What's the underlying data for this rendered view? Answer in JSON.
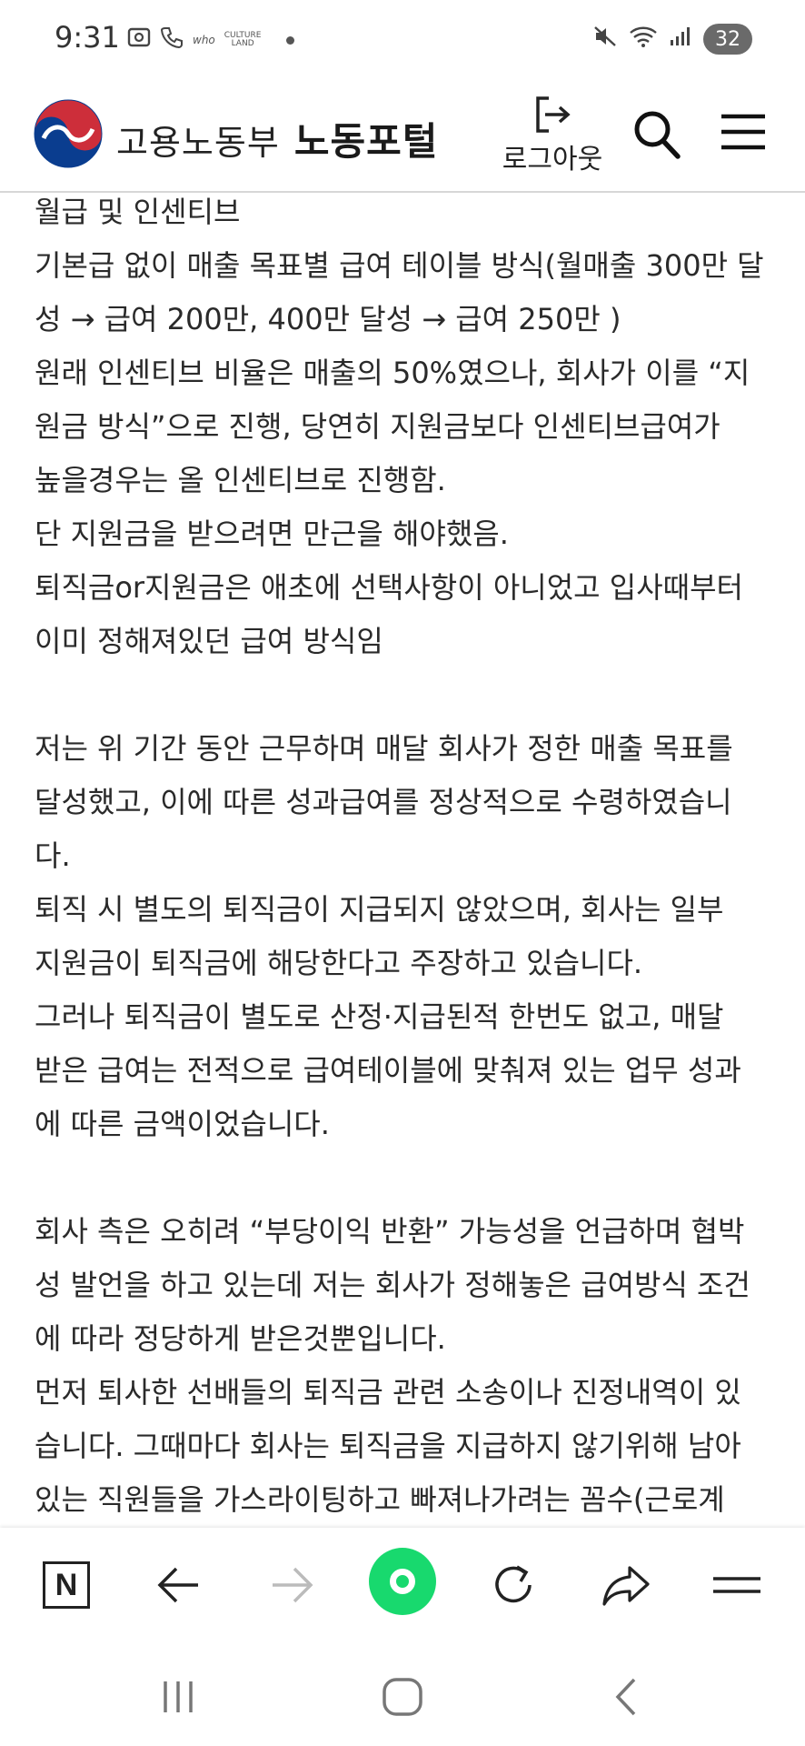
{
  "status_bar": {
    "time": "9:31",
    "battery": "32",
    "left_icons": [
      "gallery-icon",
      "phone-call-icon",
      "who-icon",
      "culture-land-icon"
    ],
    "right_icons": [
      "mute-icon",
      "wifi-icon",
      "signal-icon"
    ]
  },
  "header": {
    "ministry_name": "고용노동부",
    "portal_name": "노동포털",
    "logout_label": "로그아웃"
  },
  "content": {
    "lines": [
      "월급 및 인센티브",
      "기본급 없이 매출 목표별 급여 테이블 방식(월매출 300만 달",
      "성 → 급여 200만, 400만 달성 → 급여 250만 )",
      "원래 인센티브 비율은 매출의 50%였으나, 회사가 이를 “지",
      "원금 방식”으로 진행, 당연히 지원금보다 인센티브급여가",
      "높을경우는 올 인센티브로 진행함.",
      "단 지원금을 받으려면 만근을 해야했음.",
      "퇴직금or지원금은 애초에 선택사항이 아니었고 입사때부터",
      "이미 정해져있던 급여 방식임",
      "",
      "저는 위 기간 동안 근무하며 매달 회사가 정한 매출 목표를",
      "달성했고, 이에 따른 성과급여를 정상적으로 수령하였습니",
      "다.",
      "퇴직 시 별도의 퇴직금이 지급되지 않았으며, 회사는 일부",
      "지원금이 퇴직금에 해당한다고 주장하고 있습니다.",
      "그러나 퇴직금이 별도로 산정·지급된적 한번도 없고, 매달",
      "받은 급여는 전적으로 급여테이블에 맞춰져 있는 업무 성과",
      "에 따른 금액이었습니다.",
      "",
      "회사 측은 오히려 “부당이익 반환” 가능성을 언급하며 협박",
      "성 발언을 하고 있는데 저는 회사가 정해놓은 급여방식 조건",
      "에 따라 정당하게 받은것뿐입니다.",
      "먼저 퇴사한 선배들의 퇴직금 관련 소송이나 진정내역이 있",
      "습니다. 그때마다 회사는 퇴직금을 지급하지 않기위해 남아",
      "있는 직원들을 가스라이팅하고 빠져나가려는 꼼수(근로계"
    ]
  },
  "toolbar": {
    "naver_label": "N",
    "icons": [
      "naver-home-icon",
      "back-arrow-icon",
      "forward-arrow-icon",
      "green-dot-icon",
      "refresh-icon",
      "share-icon",
      "menu-icon"
    ]
  },
  "navbar": {
    "icons": [
      "recent-apps-icon",
      "home-icon",
      "back-icon"
    ]
  },
  "colors": {
    "green_accent": "#18d96e",
    "logo_red": "#cd2e3a",
    "logo_blue": "#0047a0"
  }
}
